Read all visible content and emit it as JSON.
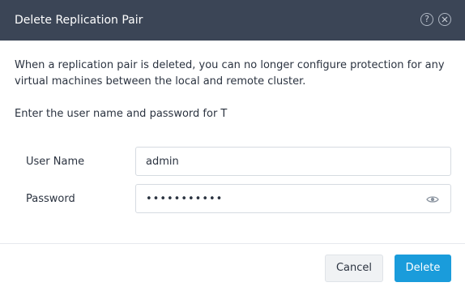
{
  "dialog": {
    "title": "Delete Replication Pair",
    "help_icon": "help-icon",
    "close_icon": "close-icon",
    "help_glyph": "?",
    "description": "When a replication pair is deleted, you can no longer configure protection for any virtual machines between the local and remote cluster.",
    "prompt": "Enter the user name and password for T"
  },
  "form": {
    "username_label": "User Name",
    "username_value": "admin",
    "password_label": "Password",
    "password_value": "•••••••••••",
    "password_toggle_icon": "eye-icon"
  },
  "footer": {
    "cancel_label": "Cancel",
    "delete_label": "Delete"
  },
  "colors": {
    "header_bg": "#3b4556",
    "primary": "#1a9cdb",
    "text": "#2b3340"
  }
}
